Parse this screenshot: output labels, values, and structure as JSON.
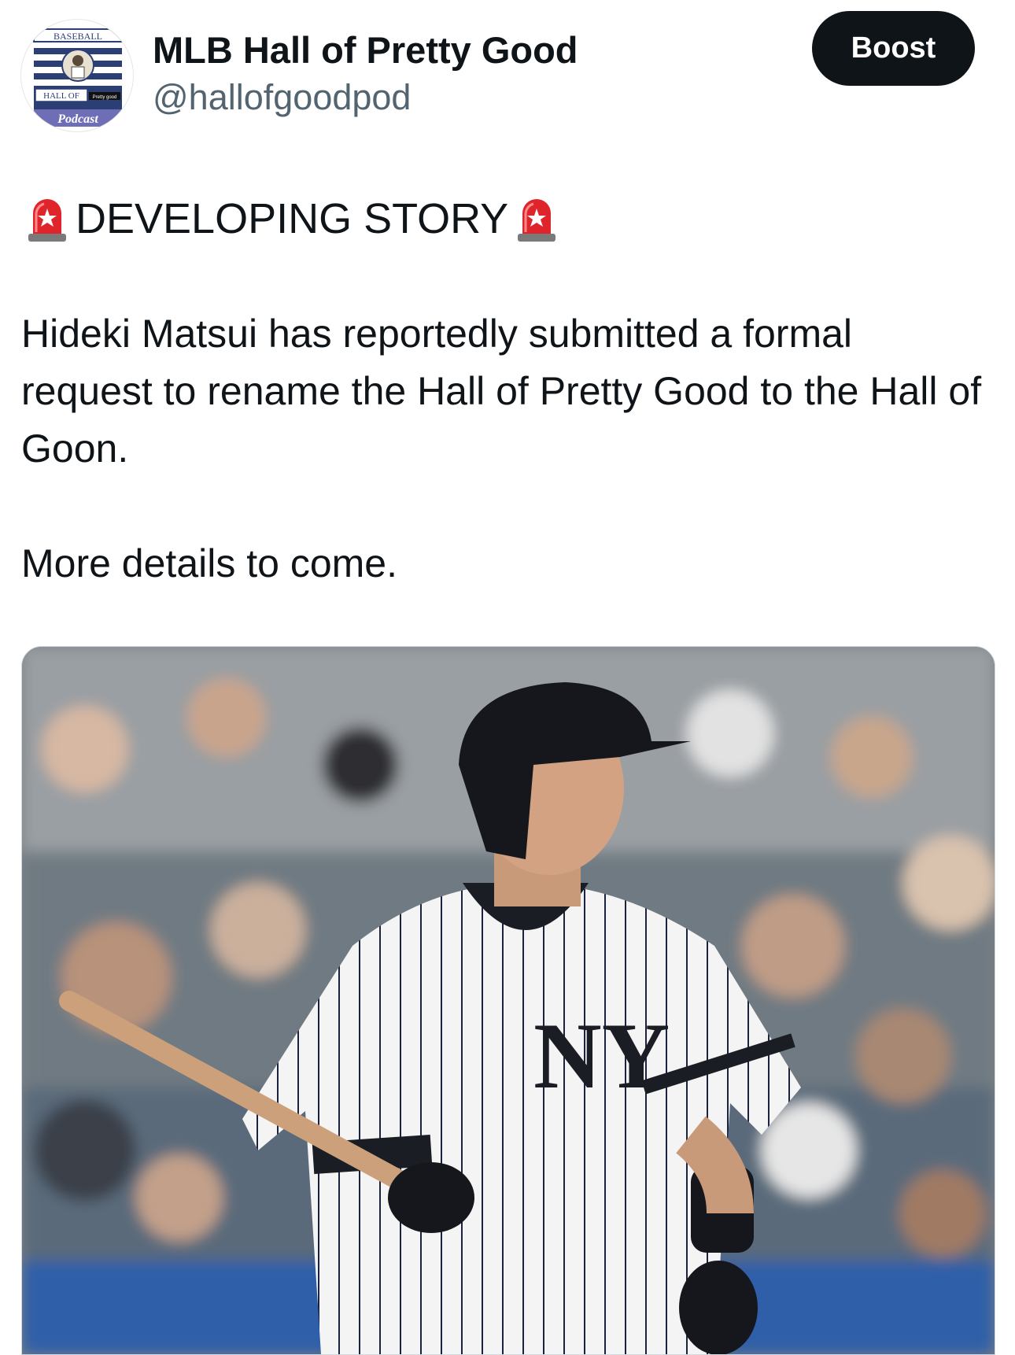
{
  "account": {
    "display_name": "MLB Hall of Pretty Good",
    "handle": "@hallofgoodpod",
    "avatar": {
      "top_text": "BASEBALL",
      "hall_text": "HALL OF",
      "tag_text": "Pretty good",
      "bottom_text": "Podcast"
    }
  },
  "actions": {
    "boost_label": "Boost"
  },
  "post": {
    "headline": "DEVELOPING STORY",
    "headline_icon": "police-siren-icon",
    "paragraph_1": "Hideki Matsui has reportedly submitted a formal request to rename the Hall of Pretty Good to the Hall of Goon.",
    "paragraph_2": "More details to come."
  },
  "colors": {
    "text": "#0f1419",
    "secondary_text": "#536471",
    "button_bg": "#0f1419",
    "button_text": "#ffffff"
  }
}
